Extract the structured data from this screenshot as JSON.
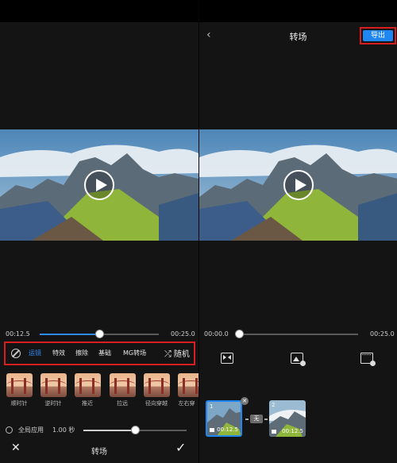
{
  "colors": {
    "accent": "#2f8af5",
    "highlight": "#d81e1e",
    "background": "#141414"
  },
  "left_panel": {
    "time_current": "00:12.5",
    "time_total": "00:25.0",
    "progress": 0.5,
    "categories": [
      "运镜",
      "特效",
      "擦除",
      "基础",
      "MG转场"
    ],
    "active_category": "运镜",
    "random_label": "随机",
    "transitions": [
      "顺时针",
      "逆时针",
      "推近",
      "拉远",
      "径向穿越",
      "左右穿"
    ],
    "apply_all_label": "全局应用",
    "duration": "1.00 秒",
    "duration_level": 0.5,
    "title": "转场",
    "icons": {
      "none": "no-effect-icon",
      "random": "shuffle-icon",
      "close": "close-icon",
      "confirm": "check-icon"
    }
  },
  "right_panel": {
    "title": "转场",
    "export_label": "导出",
    "time_current": "00:00.0",
    "time_total": "00:25.0",
    "progress": 0.0,
    "clips": [
      {
        "number": "1",
        "duration": "00:12.5"
      },
      {
        "number": "2",
        "duration": "00:12.5"
      }
    ],
    "transition_badge": "无",
    "icons": {
      "back": "back-chevron-icon",
      "bow": "transition-icon",
      "image": "image-add-icon",
      "film": "film-add-icon"
    }
  }
}
